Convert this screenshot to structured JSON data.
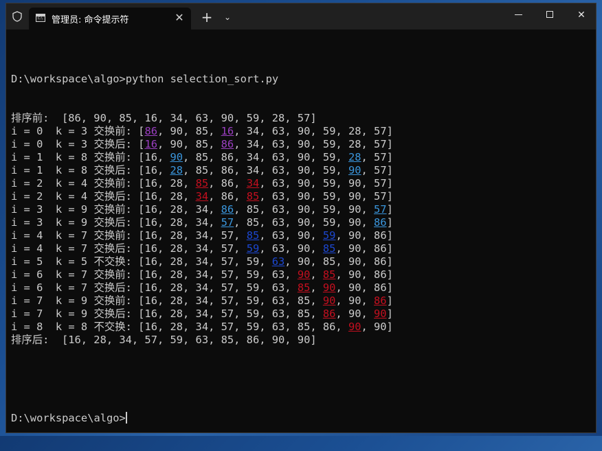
{
  "window": {
    "tab_title": "管理员: 命令提示符",
    "tab_icon_text": "C:\\",
    "new_tab": "+",
    "dropdown": "⌄",
    "close_tab": "✕",
    "close": "✕"
  },
  "console": {
    "prompt_path": "D:\\workspace\\algo>",
    "command": "D:\\workspace\\algo>python selection_sort.py",
    "colors": {
      "text": "#cccccc",
      "purple": "#9b3fc2",
      "blue1": "#3a96dd",
      "red": "#c50f1f",
      "blue2": "#1c47d1"
    },
    "lines": [
      [
        {
          "t": "排序前:  [86, 90, 85, 16, 34, 63, 90, 59, 28, 57]"
        }
      ],
      [
        {
          "t": "i = 0  k = 3 交换前: ["
        },
        {
          "t": "86",
          "c": "purple"
        },
        {
          "t": ", 90, 85, "
        },
        {
          "t": "16",
          "c": "purple"
        },
        {
          "t": ", 34, 63, 90, 59, 28, 57]"
        }
      ],
      [
        {
          "t": "i = 0  k = 3 交换后: ["
        },
        {
          "t": "16",
          "c": "purple"
        },
        {
          "t": ", 90, 85, "
        },
        {
          "t": "86",
          "c": "purple"
        },
        {
          "t": ", 34, 63, 90, 59, 28, 57]"
        }
      ],
      [
        {
          "t": "i = 1  k = 8 交换前: [16, "
        },
        {
          "t": "90",
          "c": "blue1"
        },
        {
          "t": ", 85, 86, 34, 63, 90, 59, "
        },
        {
          "t": "28",
          "c": "blue1"
        },
        {
          "t": ", 57]"
        }
      ],
      [
        {
          "t": "i = 1  k = 8 交换后: [16, "
        },
        {
          "t": "28",
          "c": "blue1"
        },
        {
          "t": ", 85, 86, 34, 63, 90, 59, "
        },
        {
          "t": "90",
          "c": "blue1"
        },
        {
          "t": ", 57]"
        }
      ],
      [
        {
          "t": "i = 2  k = 4 交换前: [16, 28, "
        },
        {
          "t": "85",
          "c": "red"
        },
        {
          "t": ", 86, "
        },
        {
          "t": "34",
          "c": "red"
        },
        {
          "t": ", 63, 90, 59, 90, 57]"
        }
      ],
      [
        {
          "t": "i = 2  k = 4 交换后: [16, 28, "
        },
        {
          "t": "34",
          "c": "red"
        },
        {
          "t": ", 86, "
        },
        {
          "t": "85",
          "c": "red"
        },
        {
          "t": ", 63, 90, 59, 90, 57]"
        }
      ],
      [
        {
          "t": "i = 3  k = 9 交换前: [16, 28, 34, "
        },
        {
          "t": "86",
          "c": "blue1"
        },
        {
          "t": ", 85, 63, 90, 59, 90, "
        },
        {
          "t": "57",
          "c": "blue1"
        },
        {
          "t": "]"
        }
      ],
      [
        {
          "t": "i = 3  k = 9 交换后: [16, 28, 34, "
        },
        {
          "t": "57",
          "c": "blue1"
        },
        {
          "t": ", 85, 63, 90, 59, 90, "
        },
        {
          "t": "86",
          "c": "blue1"
        },
        {
          "t": "]"
        }
      ],
      [
        {
          "t": "i = 4  k = 7 交换前: [16, 28, 34, 57, "
        },
        {
          "t": "85",
          "c": "blue2"
        },
        {
          "t": ", 63, 90, "
        },
        {
          "t": "59",
          "c": "blue2"
        },
        {
          "t": ", 90, 86]"
        }
      ],
      [
        {
          "t": "i = 4  k = 7 交换后: [16, 28, 34, 57, "
        },
        {
          "t": "59",
          "c": "blue2"
        },
        {
          "t": ", 63, 90, "
        },
        {
          "t": "85",
          "c": "blue2"
        },
        {
          "t": ", 90, 86]"
        }
      ],
      [
        {
          "t": "i = 5  k = 5 不交换: [16, 28, 34, 57, 59, "
        },
        {
          "t": "63",
          "c": "blue2"
        },
        {
          "t": ", 90, 85, 90, 86]"
        }
      ],
      [
        {
          "t": "i = 6  k = 7 交换前: [16, 28, 34, 57, 59, 63, "
        },
        {
          "t": "90",
          "c": "red"
        },
        {
          "t": ", "
        },
        {
          "t": "85",
          "c": "red"
        },
        {
          "t": ", 90, 86]"
        }
      ],
      [
        {
          "t": "i = 6  k = 7 交换后: [16, 28, 34, 57, 59, 63, "
        },
        {
          "t": "85",
          "c": "red"
        },
        {
          "t": ", "
        },
        {
          "t": "90",
          "c": "red"
        },
        {
          "t": ", 90, 86]"
        }
      ],
      [
        {
          "t": "i = 7  k = 9 交换前: [16, 28, 34, 57, 59, 63, 85, "
        },
        {
          "t": "90",
          "c": "red"
        },
        {
          "t": ", 90, "
        },
        {
          "t": "86",
          "c": "red"
        },
        {
          "t": "]"
        }
      ],
      [
        {
          "t": "i = 7  k = 9 交换后: [16, 28, 34, 57, 59, 63, 85, "
        },
        {
          "t": "86",
          "c": "red"
        },
        {
          "t": ", 90, "
        },
        {
          "t": "90",
          "c": "red"
        },
        {
          "t": "]"
        }
      ],
      [
        {
          "t": "i = 8  k = 8 不交换: [16, 28, 34, 57, 59, 63, 85, 86, "
        },
        {
          "t": "90",
          "c": "red"
        },
        {
          "t": ", 90]"
        }
      ],
      [
        {
          "t": "排序后:  [16, 28, 34, 57, 59, 63, 85, 86, 90, 90]"
        }
      ]
    ]
  }
}
